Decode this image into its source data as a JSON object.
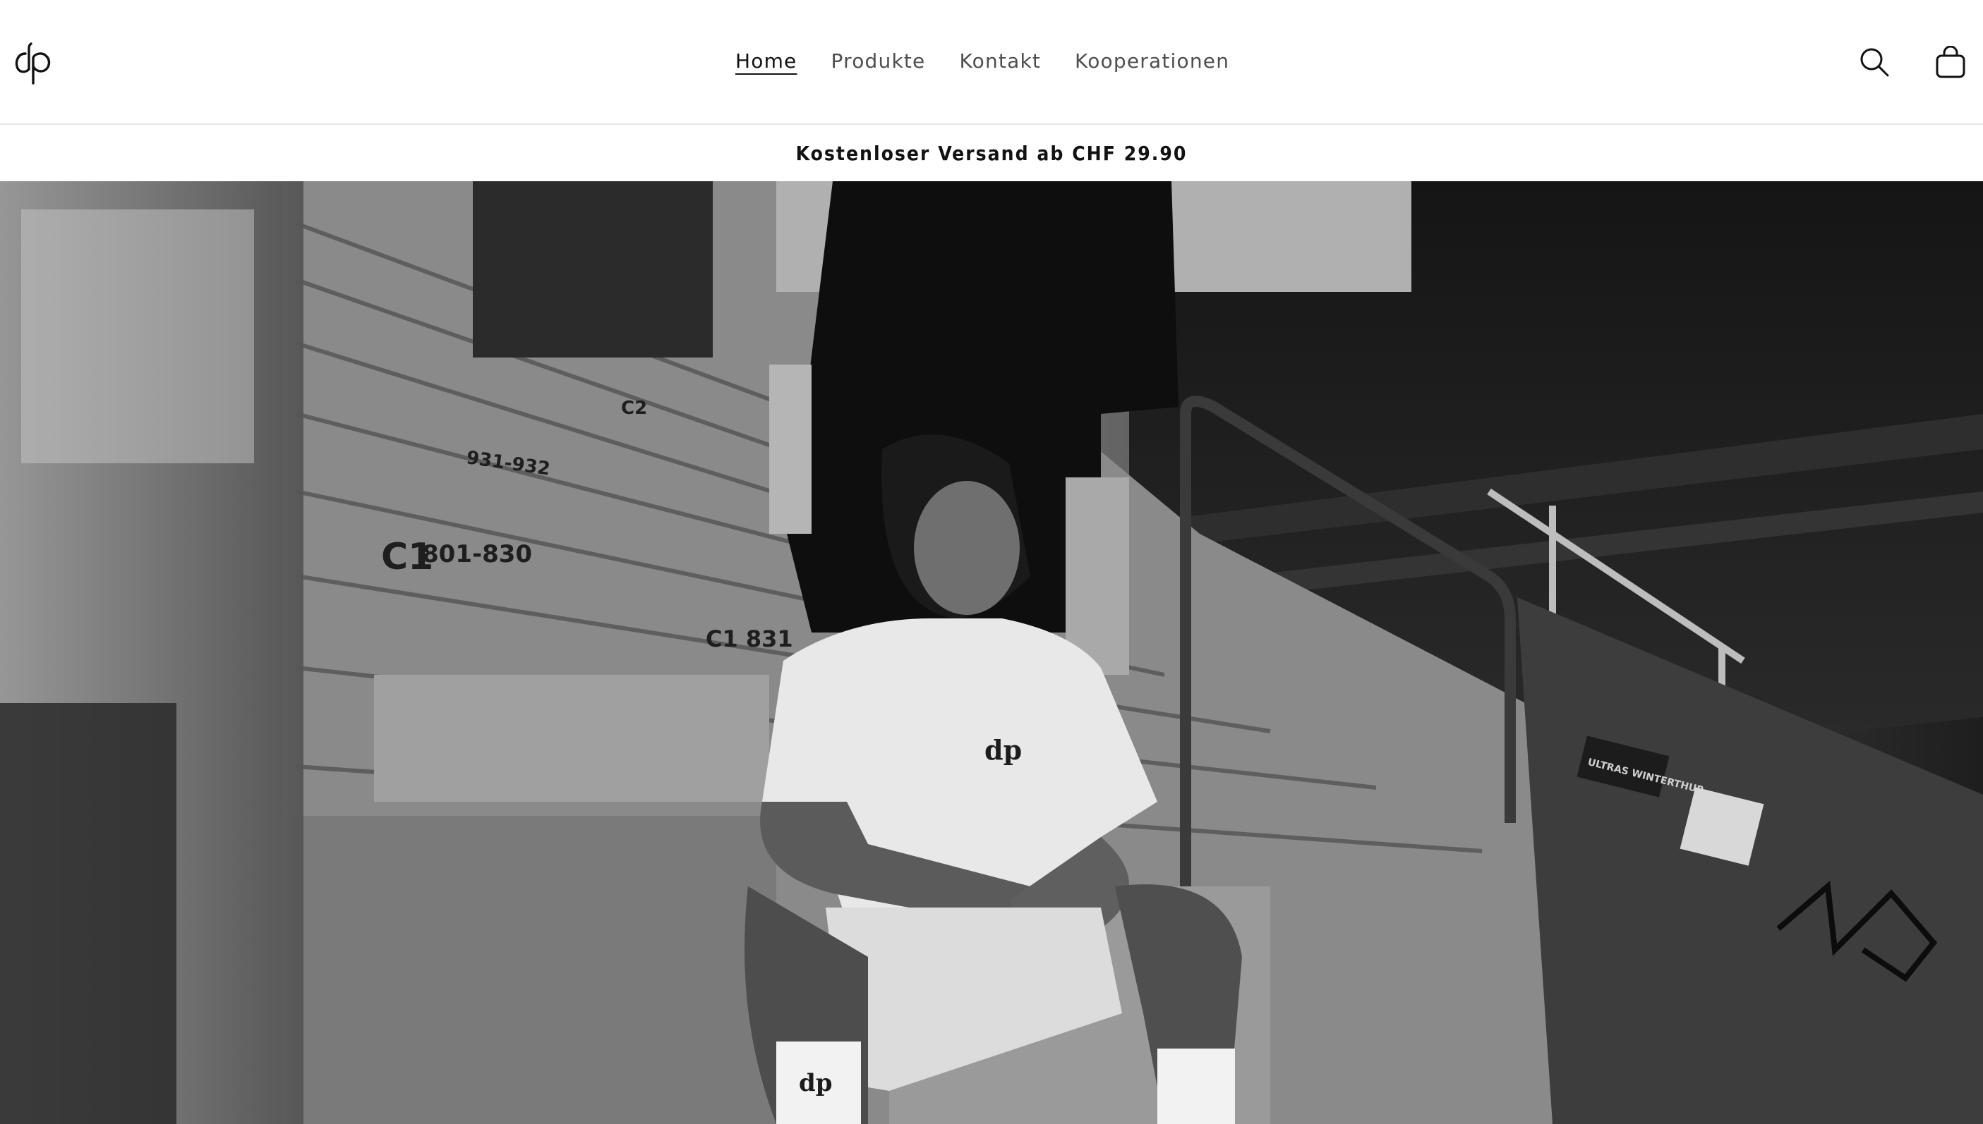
{
  "header": {
    "logo_text": "dp",
    "nav": [
      {
        "label": "Home",
        "active": true
      },
      {
        "label": "Produkte",
        "active": false
      },
      {
        "label": "Kontakt",
        "active": false
      },
      {
        "label": "Kooperationen",
        "active": false
      }
    ],
    "icons": [
      "search-icon",
      "cart-icon"
    ]
  },
  "announcement": {
    "text": "Kostenloser Versand ab CHF 29.90"
  },
  "hero": {
    "image_style": "grayscale",
    "seat_labels": [
      "C1",
      "801-830",
      "931-932",
      "C2",
      "C1",
      "831",
      "C2"
    ],
    "sticker_text": [
      "ULTRAS WINTERTHUR",
      "WINTERTHUR"
    ]
  }
}
